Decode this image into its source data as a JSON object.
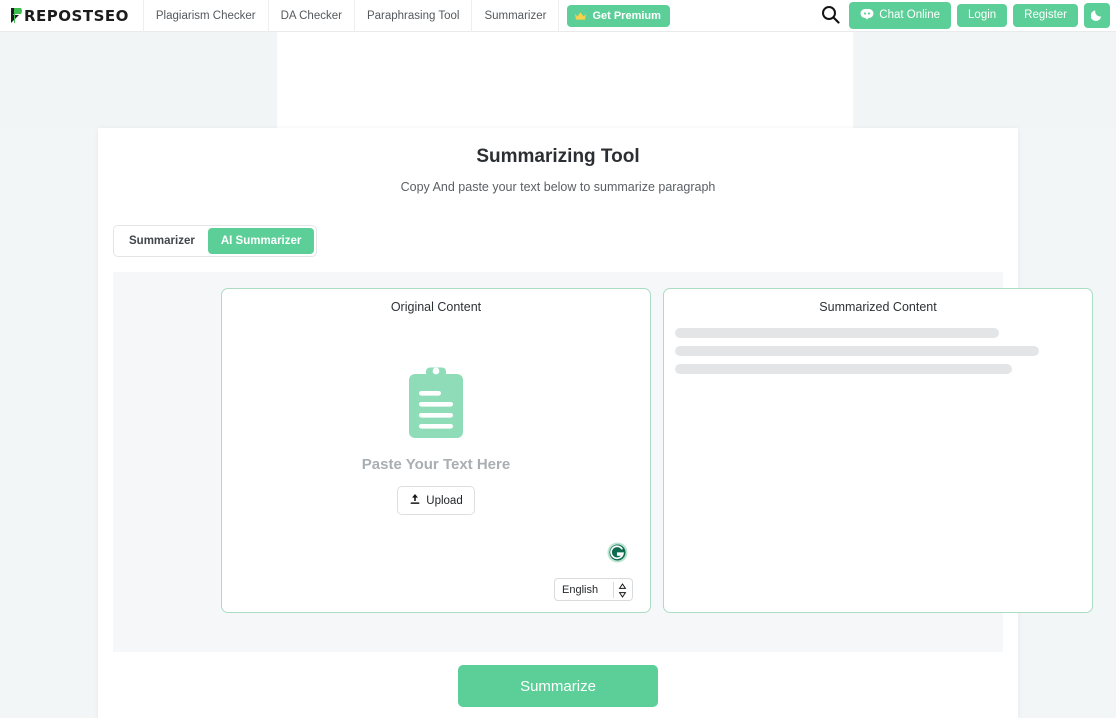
{
  "header": {
    "logo_text": "REPOSTSEO",
    "logo_icon": "prepostseo-p-mark",
    "nav_items": [
      {
        "label": "Plagiarism Checker"
      },
      {
        "label": "DA Checker"
      },
      {
        "label": "Paraphrasing Tool"
      },
      {
        "label": "Summarizer"
      }
    ],
    "premium_label": "Get Premium",
    "premium_icon": "crown-icon",
    "search_icon": "search-icon",
    "chat_label": "Chat Online",
    "chat_icon": "chat-bubble-icon",
    "login_label": "Login",
    "register_label": "Register",
    "theme_toggle_icon": "moon-icon"
  },
  "main": {
    "title": "Summarizing Tool",
    "subtitle": "Copy And paste your text below to summarize paragraph",
    "tabs": [
      {
        "label": "Summarizer",
        "active": false
      },
      {
        "label": "AI Summarizer",
        "active": true
      }
    ],
    "left_panel": {
      "heading": "Original Content",
      "placeholder_icon": "clipboard-icon",
      "paste_label": "Paste Your Text Here",
      "upload_label": "Upload",
      "upload_icon": "upload-icon",
      "grammarly_icon": "grammarly-icon",
      "language_value": "English",
      "language_icon": "updown-chevron-icon"
    },
    "right_panel": {
      "heading": "Summarized Content",
      "skeleton_widths": [
        324,
        364,
        337
      ]
    },
    "summarize_label": "Summarize"
  },
  "colors": {
    "accent_green": "#5ccf98",
    "panel_border": "#abdcc4",
    "skeleton": "#e4e5e7",
    "page_bg": "#f1f5f6"
  }
}
